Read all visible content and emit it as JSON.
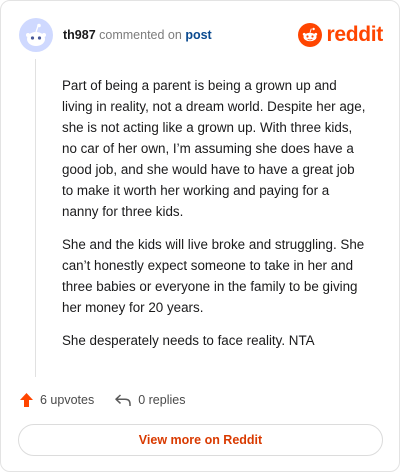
{
  "header": {
    "username": "th987",
    "commented_on": "commented on",
    "post_link": "post",
    "brand": "reddit"
  },
  "comment": {
    "paragraphs": [
      "Part of being a parent is being a grown up and living in reality, not a dream world. Despite her age, she is not acting like a grown up. With three kids, no car of her own, I’m assuming she does have a good job, and she would have to have a great job to make it worth her working and paying for a nanny for three kids.",
      "She and the kids will live broke and struggling. She can’t honestly expect someone to take in her and three babies or everyone in the family to be giving her money for 20 years.",
      "She desperately needs to face reality. NTA"
    ]
  },
  "actions": {
    "upvotes_label": "6 upvotes",
    "replies_label": "0 replies"
  },
  "footer": {
    "view_more_label": "View more on Reddit"
  },
  "colors": {
    "brand": "#ff4500",
    "view_more": "#d93a00",
    "avatar_bg": "#cfd9ff"
  },
  "icons": {
    "avatar": "snoo-avatar-icon",
    "brand": "reddit-logo-icon",
    "upvote": "upvote-arrow-icon",
    "reply": "reply-arrow-icon"
  }
}
